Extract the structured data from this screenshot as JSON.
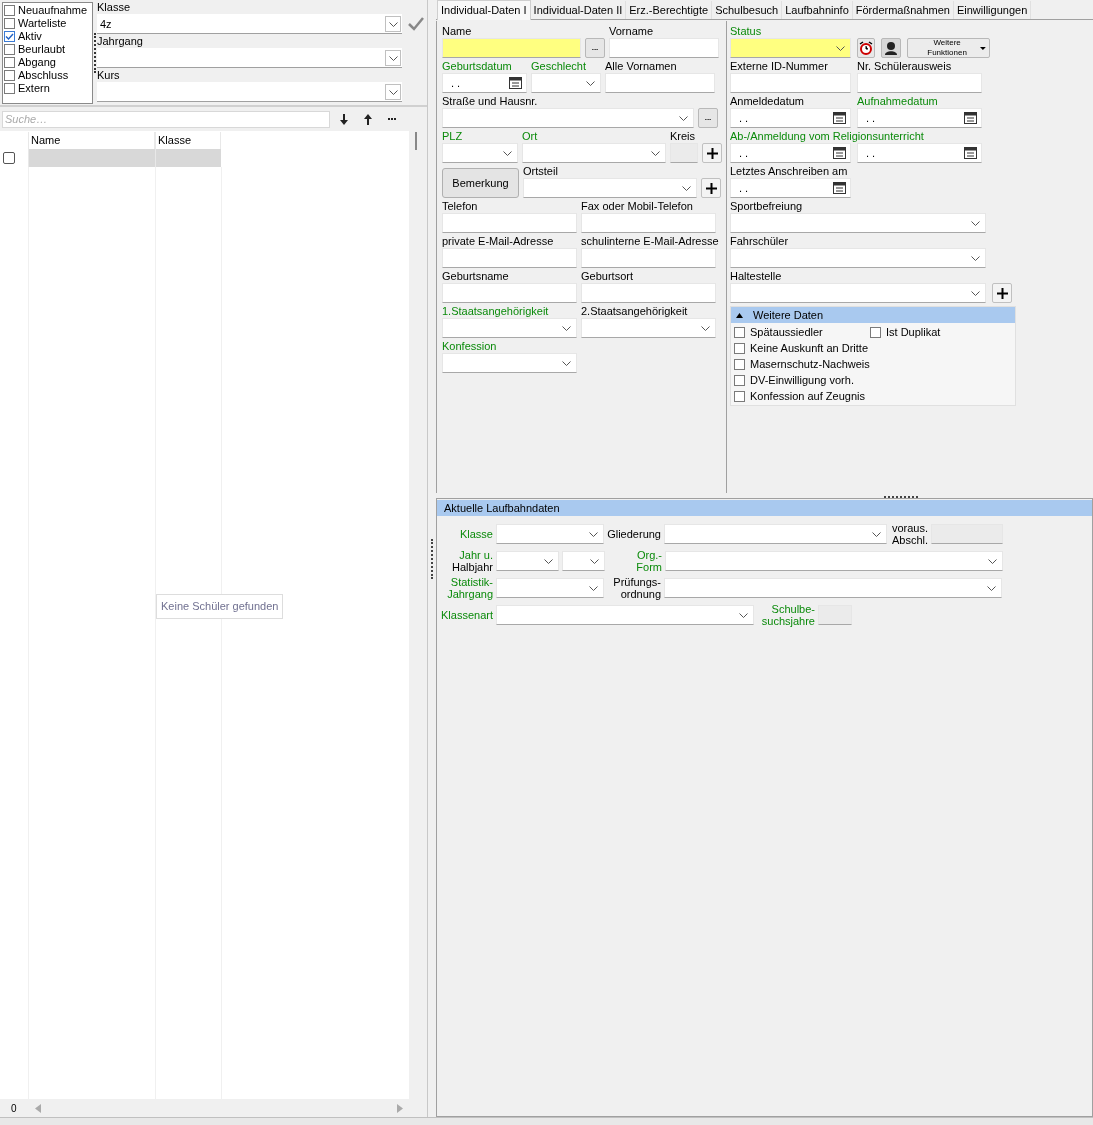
{
  "filters": [
    {
      "label": "Neuaufnahme",
      "checked": false
    },
    {
      "label": "Warteliste",
      "checked": false
    },
    {
      "label": "Aktiv",
      "checked": true
    },
    {
      "label": "Beurlaubt",
      "checked": false
    },
    {
      "label": "Abgang",
      "checked": false
    },
    {
      "label": "Abschluss",
      "checked": false
    },
    {
      "label": "Extern",
      "checked": false
    }
  ],
  "selectors": [
    {
      "label": "Klasse",
      "value": "4z"
    },
    {
      "label": "Jahrgang"
    },
    {
      "label": "Kurs"
    }
  ],
  "search": {
    "placeholder": "Suche…"
  },
  "student_list": {
    "columns": [
      "Name",
      "Klasse"
    ],
    "empty_message": "Keine Schüler gefunden",
    "rows": [
      {
        "checked": false
      }
    ],
    "row_count": "0"
  },
  "tabs": [
    {
      "label": "Individual-Daten I",
      "selected": true
    },
    {
      "label": "Individual-Daten II",
      "selected": false
    },
    {
      "label": "Erz.-Berechtigte",
      "selected": false
    },
    {
      "label": "Schulbesuch",
      "selected": false
    },
    {
      "label": "Laufbahninfo",
      "selected": false
    },
    {
      "label": "Fördermaßnahmen",
      "selected": false
    },
    {
      "label": "Einwilligungen",
      "selected": false
    }
  ],
  "personal_form": {
    "left_rows": [
      {
        "fields": [
          {
            "kind": "text",
            "label": "Name",
            "required": false,
            "highlighted": true
          },
          {
            "kind": "ellipsis",
            "text": "..."
          },
          {
            "kind": "text",
            "label": "Vorname",
            "required": false,
            "highlighted": false
          }
        ]
      },
      {
        "fields": [
          {
            "kind": "date",
            "label": "Geburtsdatum",
            "required": true,
            "value": ". ."
          },
          {
            "kind": "combo",
            "label": "Geschlecht",
            "required": true,
            "highlighted": false
          },
          {
            "kind": "text",
            "label": "Alle Vornamen",
            "required": false,
            "highlighted": false
          }
        ]
      },
      {
        "fields": [
          {
            "kind": "combo",
            "label": "Straße und Hausnr.",
            "required": false,
            "highlighted": false
          },
          {
            "kind": "ellipsis",
            "text": "..."
          }
        ]
      },
      {
        "fields": [
          {
            "kind": "combo",
            "label": "PLZ",
            "required": true,
            "highlighted": false
          },
          {
            "kind": "combo",
            "label": "Ort",
            "required": true,
            "highlighted": false
          },
          {
            "kind": "text",
            "label": "Kreis",
            "required": false,
            "disabled": true
          },
          {
            "kind": "add"
          }
        ]
      },
      {
        "fields": [
          {
            "kind": "push",
            "text": "Bemerkung"
          },
          {
            "kind": "combo",
            "label": "Ortsteil",
            "required": false,
            "highlighted": false
          },
          {
            "kind": "add"
          }
        ]
      },
      {
        "fields": [
          {
            "kind": "text",
            "label": "Telefon",
            "required": false,
            "highlighted": false
          },
          {
            "kind": "text",
            "label": "Fax oder Mobil-Telefon",
            "required": false,
            "highlighted": false
          }
        ]
      },
      {
        "fields": [
          {
            "kind": "text",
            "label": "private E-Mail-Adresse",
            "required": false,
            "highlighted": false
          },
          {
            "kind": "text",
            "label": "schulinterne E-Mail-Adresse",
            "required": false,
            "highlighted": false
          }
        ]
      },
      {
        "fields": [
          {
            "kind": "text",
            "label": "Geburtsname",
            "required": false,
            "highlighted": false
          },
          {
            "kind": "text",
            "label": "Geburtsort",
            "required": false,
            "highlighted": false
          }
        ]
      },
      {
        "fields": [
          {
            "kind": "combo",
            "label": "1.Staatsangehörigkeit",
            "required": true,
            "highlighted": false
          },
          {
            "kind": "combo",
            "label": "2.Staatsangehörigkeit",
            "required": false,
            "highlighted": false
          }
        ]
      },
      {
        "fields": [
          {
            "kind": "combo",
            "label": "Konfession",
            "required": true,
            "highlighted": false
          }
        ]
      }
    ],
    "right_rows": [
      {
        "fields": [
          {
            "kind": "combo",
            "label": "Status",
            "required": true,
            "highlighted": true
          },
          {
            "kind": "alarm"
          },
          {
            "kind": "person"
          },
          {
            "kind": "menu",
            "text": "Weitere Funktionen"
          }
        ]
      },
      {
        "fields": [
          {
            "kind": "text",
            "label": "Externe ID-Nummer",
            "required": false,
            "highlighted": false
          },
          {
            "kind": "text",
            "label": "Nr. Schülerausweis",
            "required": false,
            "highlighted": false
          }
        ]
      },
      {
        "fields": [
          {
            "kind": "date",
            "label": "Anmeldedatum",
            "required": false,
            "value": ". ."
          },
          {
            "kind": "date",
            "label": "Aufnahmedatum",
            "required": true,
            "value": ". ."
          }
        ]
      },
      {
        "label": "Ab-/Anmeldung vom Religionsunterricht",
        "required": true,
        "fields": [
          {
            "kind": "date",
            "value": ". ."
          },
          {
            "kind": "date",
            "value": ". ."
          }
        ]
      },
      {
        "fields": [
          {
            "kind": "date",
            "label": "Letztes Anschreiben am",
            "required": false,
            "value": ". ."
          }
        ]
      },
      {
        "fields": [
          {
            "kind": "combo",
            "label": "Sportbefreiung",
            "required": false,
            "highlighted": false
          }
        ]
      },
      {
        "fields": [
          {
            "kind": "combo",
            "label": "Fahrschüler",
            "required": false,
            "highlighted": false
          }
        ]
      },
      {
        "fields": [
          {
            "kind": "combo",
            "label": "Haltestelle",
            "required": false,
            "highlighted": false
          },
          {
            "kind": "add"
          }
        ]
      }
    ]
  },
  "more_data": {
    "title": "Weitere Daten",
    "expanded": true,
    "rows": [
      [
        {
          "label": "Spätaussiedler",
          "checked": false
        },
        {
          "label": "Ist Duplikat",
          "checked": false
        }
      ],
      [
        {
          "label": "Keine Auskunft an Dritte",
          "checked": false
        }
      ],
      [
        {
          "label": "Masernschutz-Nachweis",
          "checked": false
        }
      ],
      [
        {
          "label": "DV-Einwilligung vorh.",
          "checked": false
        }
      ],
      [
        {
          "label": "Konfession auf Zeugnis",
          "checked": false
        }
      ]
    ]
  },
  "career_panel": {
    "title": "Aktuelle Laufbahndaten",
    "rows": [
      [
        {
          "kind": "label",
          "lines": [
            {
              "text": "Klasse",
              "required": true
            }
          ]
        },
        {
          "kind": "combo"
        },
        {
          "kind": "label",
          "lines": [
            {
              "text": "Gliederung",
              "required": false
            }
          ]
        },
        {
          "kind": "combo"
        },
        {
          "kind": "label",
          "lines": [
            {
              "text": "voraus.",
              "required": false
            },
            {
              "text": "Abschl.",
              "required": false
            }
          ]
        },
        {
          "kind": "text",
          "disabled": true
        }
      ],
      [
        {
          "kind": "label",
          "lines": [
            {
              "text": "Jahr u.",
              "required": true
            },
            {
              "text": "Halbjahr",
              "required": false
            }
          ]
        },
        {
          "kind": "combo"
        },
        {
          "kind": "combo"
        },
        {
          "kind": "label",
          "lines": [
            {
              "text": "Org.-",
              "required": true
            },
            {
              "text": "Form",
              "required": true
            }
          ]
        },
        {
          "kind": "combo"
        }
      ],
      [
        {
          "kind": "label",
          "lines": [
            {
              "text": "Statistik-",
              "required": true
            },
            {
              "text": "Jahrgang",
              "required": true
            }
          ]
        },
        {
          "kind": "combo"
        },
        {
          "kind": "label",
          "lines": [
            {
              "text": "Prüfungs-",
              "required": false
            },
            {
              "text": "ordnung",
              "required": false
            }
          ]
        },
        {
          "kind": "combo"
        }
      ],
      [
        {
          "kind": "label",
          "lines": [
            {
              "text": "Klassenart",
              "required": true
            }
          ]
        },
        {
          "kind": "combo"
        },
        {
          "kind": "label",
          "lines": [
            {
              "text": "Schulbe-",
              "required": true
            },
            {
              "text": "suchsjahre",
              "required": true
            }
          ]
        },
        {
          "kind": "text",
          "disabled": true
        }
      ]
    ]
  }
}
